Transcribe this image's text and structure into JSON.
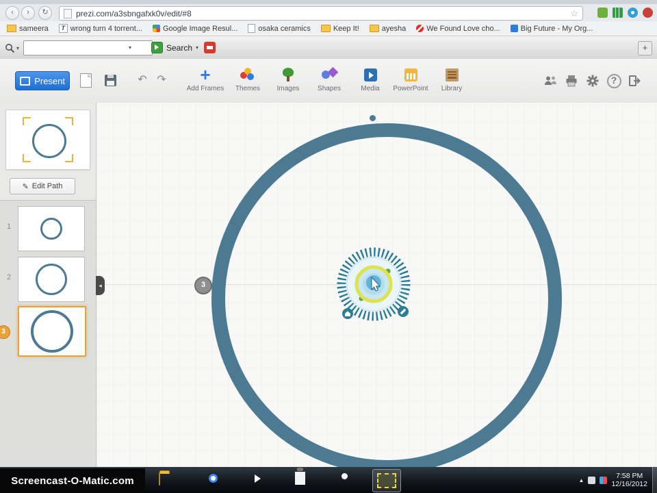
{
  "colors": {
    "accent_teal": "#4d7a93",
    "selection_orange": "#e8a23c",
    "present_blue": "#2377dd"
  },
  "browser": {
    "url": "prezi.com/a3sbngafxk0v/edit/#8",
    "bookmarks": [
      {
        "label": "sameera"
      },
      {
        "label": "wrong turn 4 torrent..."
      },
      {
        "label": "Google Image Resul..."
      },
      {
        "label": "osaka ceramics"
      },
      {
        "label": "Keep It!"
      },
      {
        "label": "ayesha"
      },
      {
        "label": "We Found Love cho..."
      },
      {
        "label": "Big Future - My Org..."
      }
    ],
    "search_toolbar": {
      "input_value": "",
      "button_label": "Search"
    }
  },
  "prezi": {
    "present_label": "Present",
    "tools": [
      {
        "label": "Add Frames"
      },
      {
        "label": "Themes"
      },
      {
        "label": "Images"
      },
      {
        "label": "Shapes"
      },
      {
        "label": "Media"
      },
      {
        "label": "PowerPoint"
      },
      {
        "label": "Library"
      }
    ]
  },
  "sidebar": {
    "edit_path_label": "Edit Path",
    "steps": [
      {
        "number": "1"
      },
      {
        "number": "2"
      },
      {
        "number": "3"
      }
    ],
    "selected_step": "3"
  },
  "canvas": {
    "path_marker_label": "3"
  },
  "taskbar": {
    "clock_time": "7:58 PM",
    "clock_date": "12/16/2012"
  },
  "watermark_text": "Screencast-O-Matic.com",
  "icons": {
    "back": "‹",
    "forward": "›",
    "reload": "↻",
    "star": "☆",
    "caret_down": "▾",
    "plus_button": "+",
    "add_frames_plus": "+",
    "undo": "↶",
    "redo": "↷",
    "pencil": "✎",
    "help": "?",
    "collapse_arrow": "◂",
    "tray_expand": "▲"
  }
}
